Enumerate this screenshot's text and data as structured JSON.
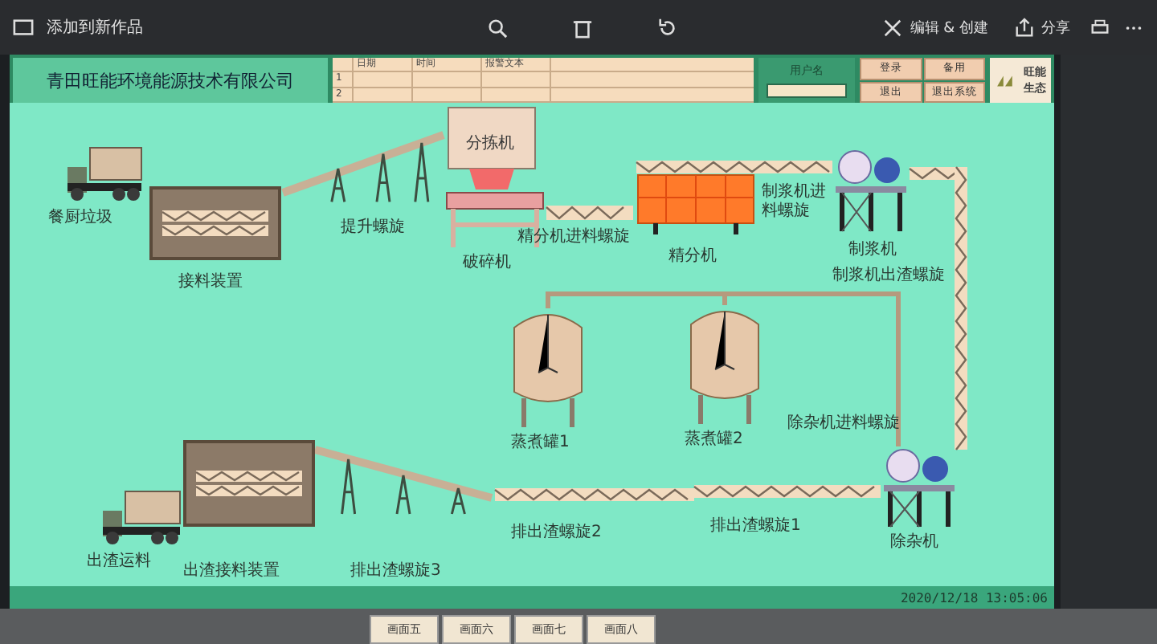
{
  "viewer_bar": {
    "title": "添加到新作品",
    "actions": [
      {
        "label": "编辑 & 创建"
      },
      {
        "label": "分享"
      }
    ]
  },
  "header": {
    "company": "青田旺能环境能源技术有限公司",
    "alarm_table": {
      "columns": [
        "日期",
        "时间",
        "报警文本"
      ],
      "rows": [
        "1",
        "2"
      ]
    },
    "user": {
      "label": "用户名"
    },
    "buttons": [
      "登录",
      "备用",
      "退出",
      "退出系统"
    ],
    "logo_text": "旺能生态"
  },
  "equipment": [
    {
      "kind": "truck",
      "label": "餐厨垃圾"
    },
    {
      "kind": "hopper",
      "label": "接料装置"
    },
    {
      "kind": "incline",
      "label": "提升螺旋"
    },
    {
      "kind": "cabinet",
      "label": "分拣机"
    },
    {
      "kind": "crusher",
      "label": "破碎机"
    },
    {
      "kind": "screw",
      "label": "精分机进料螺旋"
    },
    {
      "kind": "separator",
      "label": "精分机"
    },
    {
      "kind": "screw",
      "label": "制浆机进料螺旋"
    },
    {
      "kind": "pulper",
      "label": "制浆机"
    },
    {
      "kind": "screw",
      "label": "制浆机出渣螺旋"
    },
    {
      "kind": "tank",
      "label": "蒸煮罐1"
    },
    {
      "kind": "tank",
      "label": "蒸煮罐2"
    },
    {
      "kind": "screw",
      "label": "除杂机进料螺旋"
    },
    {
      "kind": "pulper",
      "label": "除杂机"
    },
    {
      "kind": "screw",
      "label": "排出渣螺旋1"
    },
    {
      "kind": "screw",
      "label": "排出渣螺旋2"
    },
    {
      "kind": "decline",
      "label": "排出渣螺旋3"
    },
    {
      "kind": "hopper",
      "label": "出渣接料装置"
    },
    {
      "kind": "truck",
      "label": "出渣运料"
    }
  ],
  "status_bar": {
    "datetime": "2020/12/18 13:05:06"
  },
  "tabs": [
    {
      "label": "画面五"
    },
    {
      "label": "画面六"
    },
    {
      "label": "画面七"
    },
    {
      "label": "画面八"
    }
  ]
}
